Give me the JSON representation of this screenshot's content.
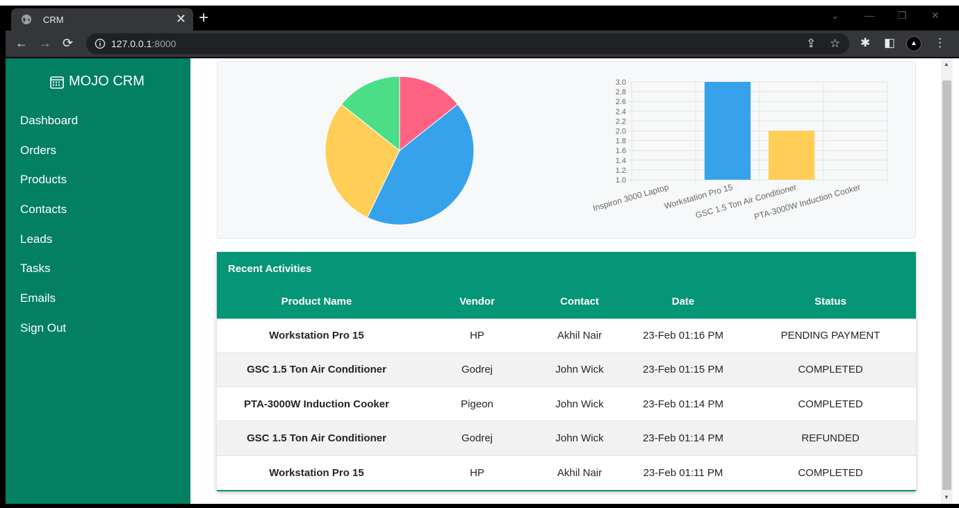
{
  "browser": {
    "tab_title": "CRM",
    "tab_close": "✕",
    "new_tab": "+",
    "url_host": "127.0.0.1",
    "url_port": ":8000"
  },
  "sidebar": {
    "brand": "MOJO CRM",
    "items": [
      {
        "label": "Dashboard"
      },
      {
        "label": "Orders"
      },
      {
        "label": "Products"
      },
      {
        "label": "Contacts"
      },
      {
        "label": "Leads"
      },
      {
        "label": "Tasks"
      },
      {
        "label": "Emails"
      },
      {
        "label": "Sign Out"
      }
    ]
  },
  "chart_data": [
    {
      "type": "pie",
      "values": [
        1,
        3,
        2,
        1
      ],
      "colors": [
        "#ff6384",
        "#36a2eb",
        "#ffce56",
        "#4bde86"
      ]
    },
    {
      "type": "bar",
      "categories": [
        "Inspiron 3000 Laptop",
        "Workstation Pro 15",
        "GSC 1.5 Ton Air Conditioner",
        "PTA-3000W Induction Cooker"
      ],
      "values": [
        1,
        3,
        2,
        1
      ],
      "ylim": [
        1.0,
        3.0
      ],
      "yticks": [
        "1.0",
        "1.2",
        "1.4",
        "1.6",
        "1.8",
        "2.0",
        "2.2",
        "2.4",
        "2.6",
        "2.8",
        "3.0"
      ],
      "colors": [
        "#ff6384",
        "#36a2eb",
        "#ffce56",
        "#4bde86"
      ],
      "grid": true
    }
  ],
  "activities": {
    "title": "Recent Activities",
    "columns": [
      "Product Name",
      "Vendor",
      "Contact",
      "Date",
      "Status"
    ],
    "rows": [
      {
        "product": "Workstation Pro 15",
        "vendor": "HP",
        "contact": "Akhil Nair",
        "date": "23-Feb 01:16 PM",
        "status": "PENDING PAYMENT"
      },
      {
        "product": "GSC 1.5 Ton Air Conditioner",
        "vendor": "Godrej",
        "contact": "John Wick",
        "date": "23-Feb 01:15 PM",
        "status": "COMPLETED"
      },
      {
        "product": "PTA-3000W Induction Cooker",
        "vendor": "Pigeon",
        "contact": "John Wick",
        "date": "23-Feb 01:14 PM",
        "status": "COMPLETED"
      },
      {
        "product": "GSC 1.5 Ton Air Conditioner",
        "vendor": "Godrej",
        "contact": "John Wick",
        "date": "23-Feb 01:14 PM",
        "status": "REFUNDED"
      },
      {
        "product": "Workstation Pro 15",
        "vendor": "HP",
        "contact": "Akhil Nair",
        "date": "23-Feb 01:11 PM",
        "status": "COMPLETED"
      }
    ]
  },
  "colors": {
    "sidebar_bg": "#037f62",
    "table_header_bg": "#059577"
  }
}
